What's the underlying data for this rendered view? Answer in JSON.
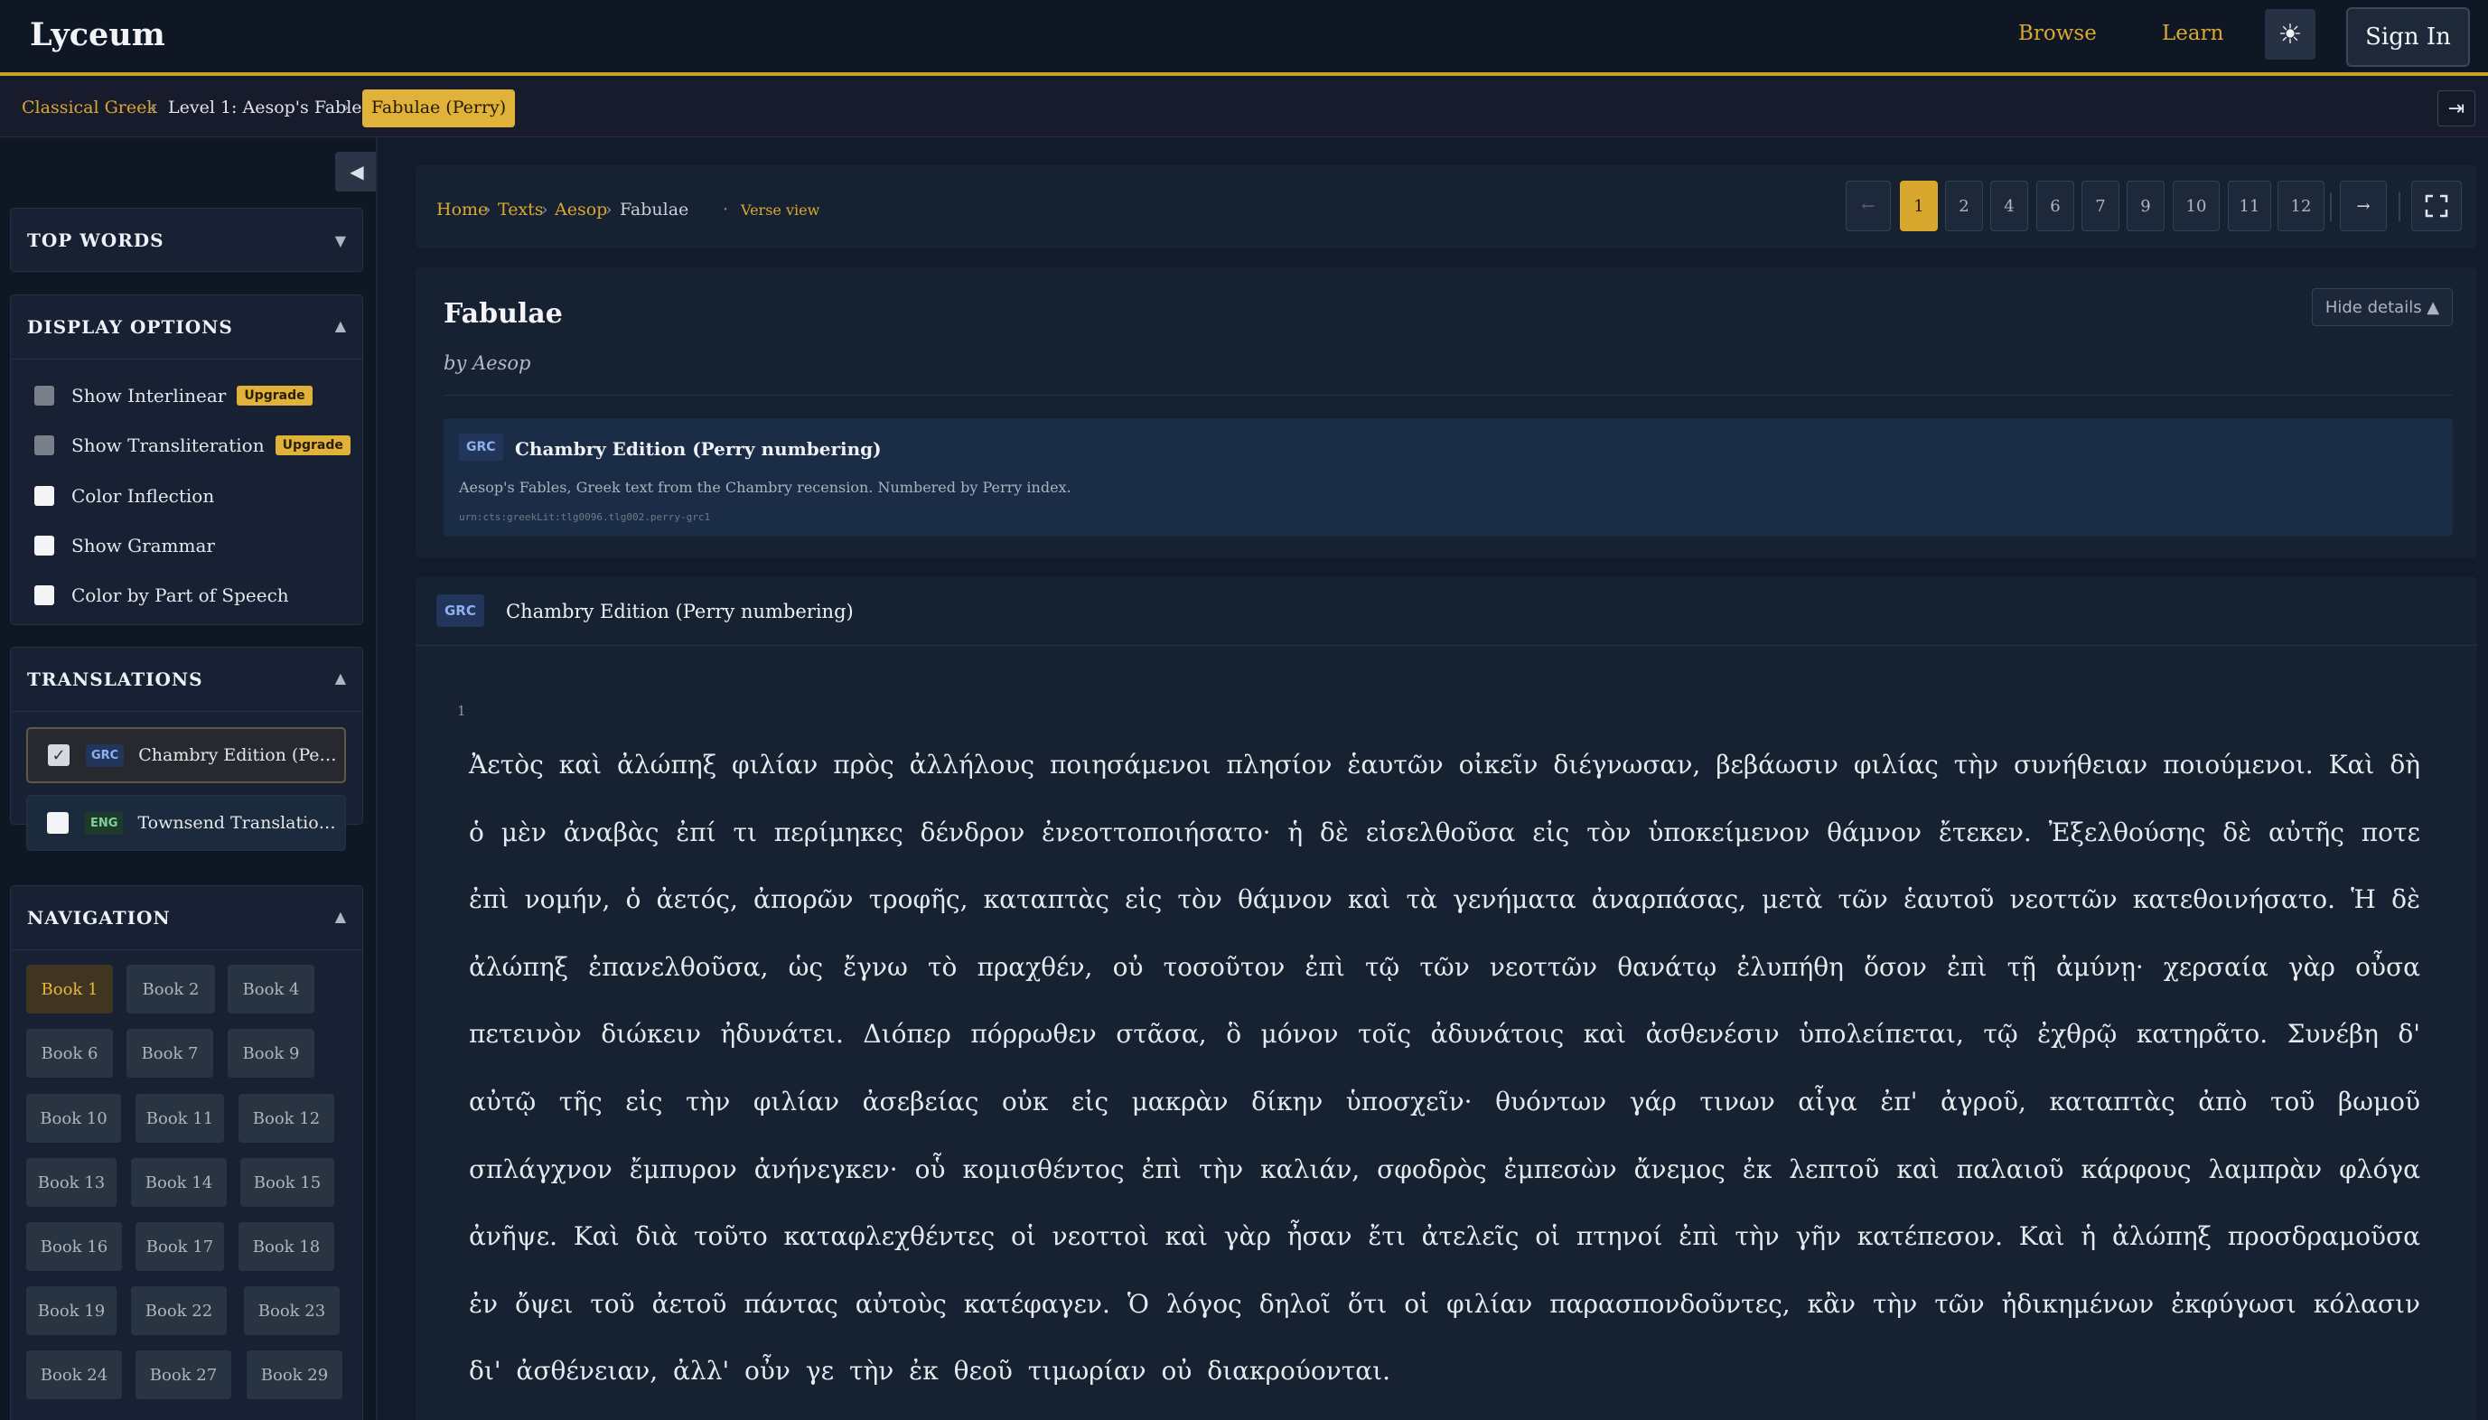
{
  "app": {
    "title": "Lyceum"
  },
  "topnav": {
    "browse": "Browse",
    "learn": "Learn",
    "sign_in": "Sign In",
    "theme_icon": "sun-icon"
  },
  "breadcrumb": {
    "items": [
      "Classical Greek",
      "Level 1: Aesop's Fables"
    ],
    "current": "Fabulae (Perry)",
    "separator": "›",
    "exit_icon": "arrow-right-exit-icon"
  },
  "sidebar": {
    "collapse_icon": "◀",
    "top_words": {
      "title": "TOP WORDS",
      "arrow": "▼"
    },
    "display_options": {
      "title": "DISPLAY OPTIONS",
      "arrow": "▲",
      "upgrade_label": "Upgrade",
      "options": [
        {
          "label": "Show Interlinear",
          "locked": true
        },
        {
          "label": "Show Transliteration",
          "locked": true
        },
        {
          "label": "Color Inflection",
          "locked": false
        },
        {
          "label": "Show Grammar",
          "locked": false
        },
        {
          "label": "Color by Part of Speech",
          "locked": false
        }
      ]
    },
    "translations": {
      "title": "TRANSLATIONS",
      "arrow": "▲",
      "items": [
        {
          "lang": "GRC",
          "name": "Chambry Edition (Perr...",
          "checked": true
        },
        {
          "lang": "ENG",
          "name": "Townsend Translation ...",
          "checked": false
        }
      ]
    },
    "navigation": {
      "title": "NAVIGATION",
      "arrow": "▲",
      "books": [
        "Book 1",
        "Book 2",
        "Book 4",
        "Book 6",
        "Book 7",
        "Book 9",
        "Book 10",
        "Book 11",
        "Book 12",
        "Book 13",
        "Book 14",
        "Book 15",
        "Book 16",
        "Book 17",
        "Book 18",
        "Book 19",
        "Book 22",
        "Book 23",
        "Book 24",
        "Book 27",
        "Book 29"
      ],
      "active": "Book 1"
    }
  },
  "toolbar": {
    "crumbs": [
      "Home",
      "Texts",
      "Aesop",
      "Fabulae"
    ],
    "separator": "›",
    "dot": "·",
    "verse_view": "Verse view",
    "prev": "←",
    "next": "→",
    "pages": [
      "1",
      "2",
      "4",
      "6",
      "7",
      "9",
      "10",
      "11",
      "12"
    ],
    "active_page": "1",
    "fullscreen_icon": "fullscreen-icon"
  },
  "details": {
    "title": "Fabulae",
    "author": "by Aesop",
    "hide_label": "Hide details ▲",
    "edition": {
      "lang": "GRC",
      "name": "Chambry Edition (Perry numbering)",
      "description": "Aesop's Fables, Greek text from the Chambry recension. Numbered by Perry index.",
      "urn": "urn:cts:greekLit:tlg0096.tlg002.perry-grc1"
    }
  },
  "reader": {
    "lang": "GRC",
    "edition": "Chambry Edition (Perry numbering)",
    "verse_number": "1",
    "text": "Ἀετὸς καὶ ἀλώπηξ φιλίαν πρὸς ἀλλήλους ποιησάμενοι πλησίον ἑαυτῶν οἰκεῖν διέγνωσαν, βεβάωσιν φιλίας τὴν συνήθειαν ποιούμενοι. Καὶ δὴ ὁ μὲν ἀναβὰς ἐπί τι περίμηκες δένδρον ἐνεοττοποιήσατο· ἡ δὲ εἰσελθοῦσα εἰς τὸν ὑποκείμενον θάμνον ἔτεκεν. Ἐξελθούσης δὲ αὐτῆς ποτε ἐπὶ νομήν, ὁ ἀετός, ἀπορῶν τροφῆς, καταπτὰς εἰς τὸν θάμνον καὶ τὰ γενήματα ἀναρπάσας, μετὰ τῶν ἑαυτοῦ νεοττῶν κατεθοινήσατο. Ἡ δὲ ἀλώπηξ ἐπανελθοῦσα, ὡς ἔγνω τὸ πραχθέν, οὐ τοσοῦτον ἐπὶ τῷ τῶν νεοττῶν θανάτῳ ἐλυπήθη ὅσον ἐπὶ τῇ ἀμύνῃ· χερσαία γὰρ οὖσα πετεινὸν διώκειν ἠδυνάτει. Διόπερ πόρρωθεν στᾶσα, ὃ μόνον τοῖς ἀδυνάτοις καὶ ἀσθενέσιν ὑπολείπεται, τῷ ἐχθρῷ κατηρᾶτο. Συνέβη δ' αὐτῷ τῆς εἰς τὴν φιλίαν ἀσεβείας οὐκ εἰς μακρὰν δίκην ὑποσχεῖν· θυόντων γάρ τινων αἶγα ἐπ' ἀγροῦ, καταπτὰς ἀπὸ τοῦ βωμοῦ σπλάγχνον ἔμπυρον ἀνήνεγκεν· οὗ κομισθέντος ἐπὶ τὴν καλιάν, σφοδρὸς ἐμπεσὼν ἄνεμος ἐκ λεπτοῦ καὶ παλαιοῦ κάρφους λαμπρὰν φλόγα ἀνῆψε. Καὶ διὰ τοῦτο καταφλεχθέντες οἱ νεοττοὶ καὶ γὰρ ἦσαν ἔτι ἀτελεῖς οἱ πτηνοί ἐπὶ τὴν γῆν κατέπεσον. Καὶ ἡ ἀλώπηξ προσδραμοῦσα ἐν ὄψει τοῦ ἀετοῦ πάντας αὐτοὺς κατέφαγεν. Ὁ λόγος δηλοῖ ὅτι οἱ φιλίαν παρασπονδοῦντες, κἂν τὴν τῶν ἠδικημένων ἐκφύγωσι κόλασιν δι' ἀσθένειαν, ἀλλ' οὖν γε τὴν ἐκ θεοῦ τιμωρίαν οὐ διακρούονται."
  },
  "colors": {
    "accent": "#d8a82e",
    "background": "#111b2b",
    "panel": "#162132"
  }
}
